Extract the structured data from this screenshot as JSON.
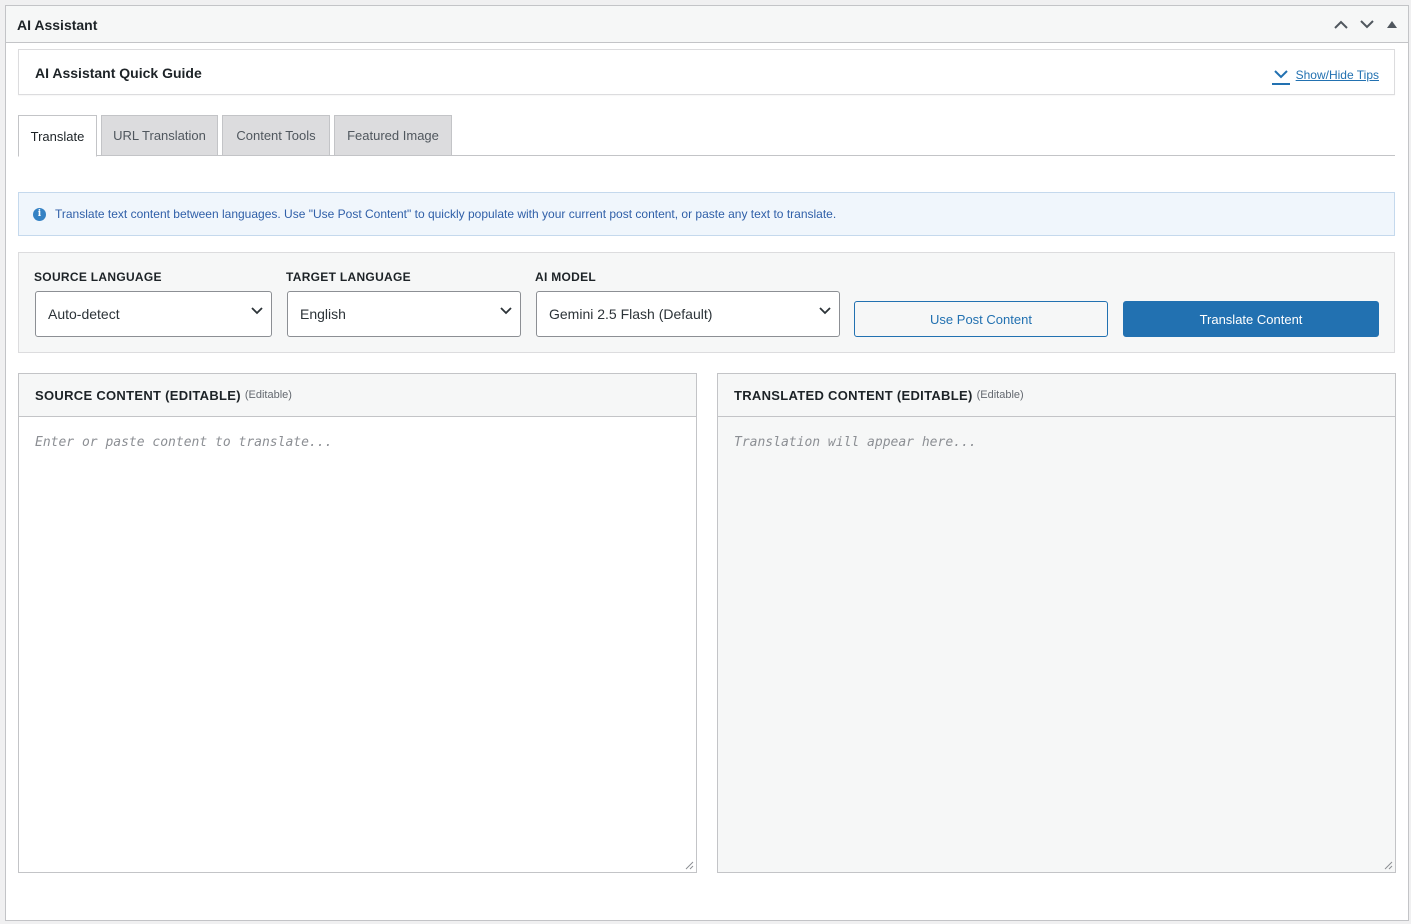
{
  "metabox": {
    "title": "AI Assistant",
    "controls": [
      "chevron-up",
      "chevron-down",
      "caret-up"
    ]
  },
  "guide": {
    "title": "AI Assistant Quick Guide",
    "toggle_label": "Show/Hide Tips"
  },
  "tabs": [
    {
      "label": "Translate",
      "active": true
    },
    {
      "label": "URL Translation",
      "active": false
    },
    {
      "label": "Content Tools",
      "active": false
    },
    {
      "label": "Featured Image",
      "active": false
    }
  ],
  "notice": {
    "icon": "info-icon",
    "text": "Translate text content between languages. Use \"Use Post Content\" to quickly populate with your current post content, or paste any text to translate."
  },
  "controls": {
    "source_language": {
      "label": "SOURCE LANGUAGE",
      "value": "Auto-detect"
    },
    "target_language": {
      "label": "TARGET LANGUAGE",
      "value": "English"
    },
    "ai_model": {
      "label": "AI MODEL",
      "value": "Gemini 2.5 Flash (Default)"
    },
    "use_post_content_label": "Use Post Content",
    "translate_label": "Translate Content"
  },
  "source_panel": {
    "title": "SOURCE CONTENT (EDITABLE)",
    "badge": "(Editable)",
    "placeholder": "Enter or paste content to translate...",
    "value": ""
  },
  "translated_panel": {
    "title": "TRANSLATED CONTENT (EDITABLE)",
    "badge": "(Editable)",
    "placeholder": "Translation will appear here...",
    "value": ""
  },
  "colors": {
    "accent": "#2271b1",
    "notice_bg": "#f0f6fc",
    "notice_text": "#2f5fa8"
  }
}
